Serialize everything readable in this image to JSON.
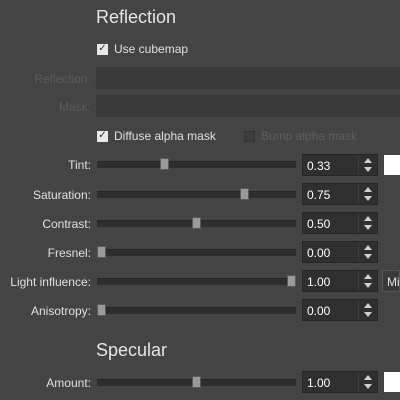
{
  "reflection": {
    "title": "Reflection",
    "use_cubemap": {
      "label": "Use cubemap",
      "checked": true
    },
    "reflection_slot": {
      "label": "Reflection:"
    },
    "mask_slot": {
      "label": "Mask:"
    },
    "diffuse_alpha_mask": {
      "label": "Diffuse alpha mask",
      "checked": true
    },
    "bump_alpha_mask": {
      "label": "Bump alpha mask",
      "checked": false,
      "enabled": false
    },
    "params": [
      {
        "label": "Tint:",
        "value": "0.33",
        "level": 0.33
      },
      {
        "label": "Saturation:",
        "value": "0.75",
        "level": 0.75
      },
      {
        "label": "Contrast:",
        "value": "0.50",
        "level": 0.5
      },
      {
        "label": "Fresnel:",
        "value": "0.00",
        "level": 0.0
      },
      {
        "label": "Light influence:",
        "value": "1.00",
        "level": 1.0
      },
      {
        "label": "Anisotropy:",
        "value": "0.00",
        "level": 0.0
      }
    ],
    "tint_color": "#ffffff",
    "light_influence_mode": "Mi"
  },
  "specular": {
    "title": "Specular",
    "params": [
      {
        "label": "Amount:",
        "value": "1.00",
        "level": 0.5
      }
    ],
    "amount_color": "#ffffff"
  },
  "colors": {
    "background": "#444444",
    "slot": "#3a3a3a",
    "spin_bg": "#2f2f2f",
    "handle": "#9a9a9a"
  }
}
